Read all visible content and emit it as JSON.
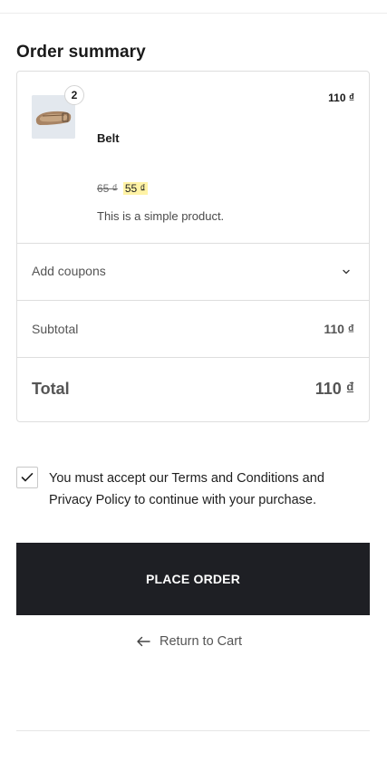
{
  "summary": {
    "title": "Order summary"
  },
  "item": {
    "name": "Belt",
    "quantity": "2",
    "line_total": "110 ₫",
    "regular_price": "65 ₫",
    "sale_price": "55 ₫",
    "description": "This is a simple product.",
    "thumbnail_icon": "belt-image"
  },
  "coupons": {
    "label": "Add coupons",
    "icon": "chevron-down-icon"
  },
  "totals": {
    "subtotal_label": "Subtotal",
    "subtotal_value": "110 ₫",
    "total_label": "Total",
    "total_value": "110 ₫"
  },
  "terms": {
    "checked": true,
    "text": "You must accept our Terms and Conditions and Privacy Policy to continue with your purchase."
  },
  "actions": {
    "place_order_label": "PLACE ORDER",
    "return_label": "Return to Cart",
    "return_icon": "arrow-left-icon"
  },
  "colors": {
    "button_bg": "#1e1f24",
    "sale_highlight": "#fff3a6",
    "border": "#dedede"
  }
}
